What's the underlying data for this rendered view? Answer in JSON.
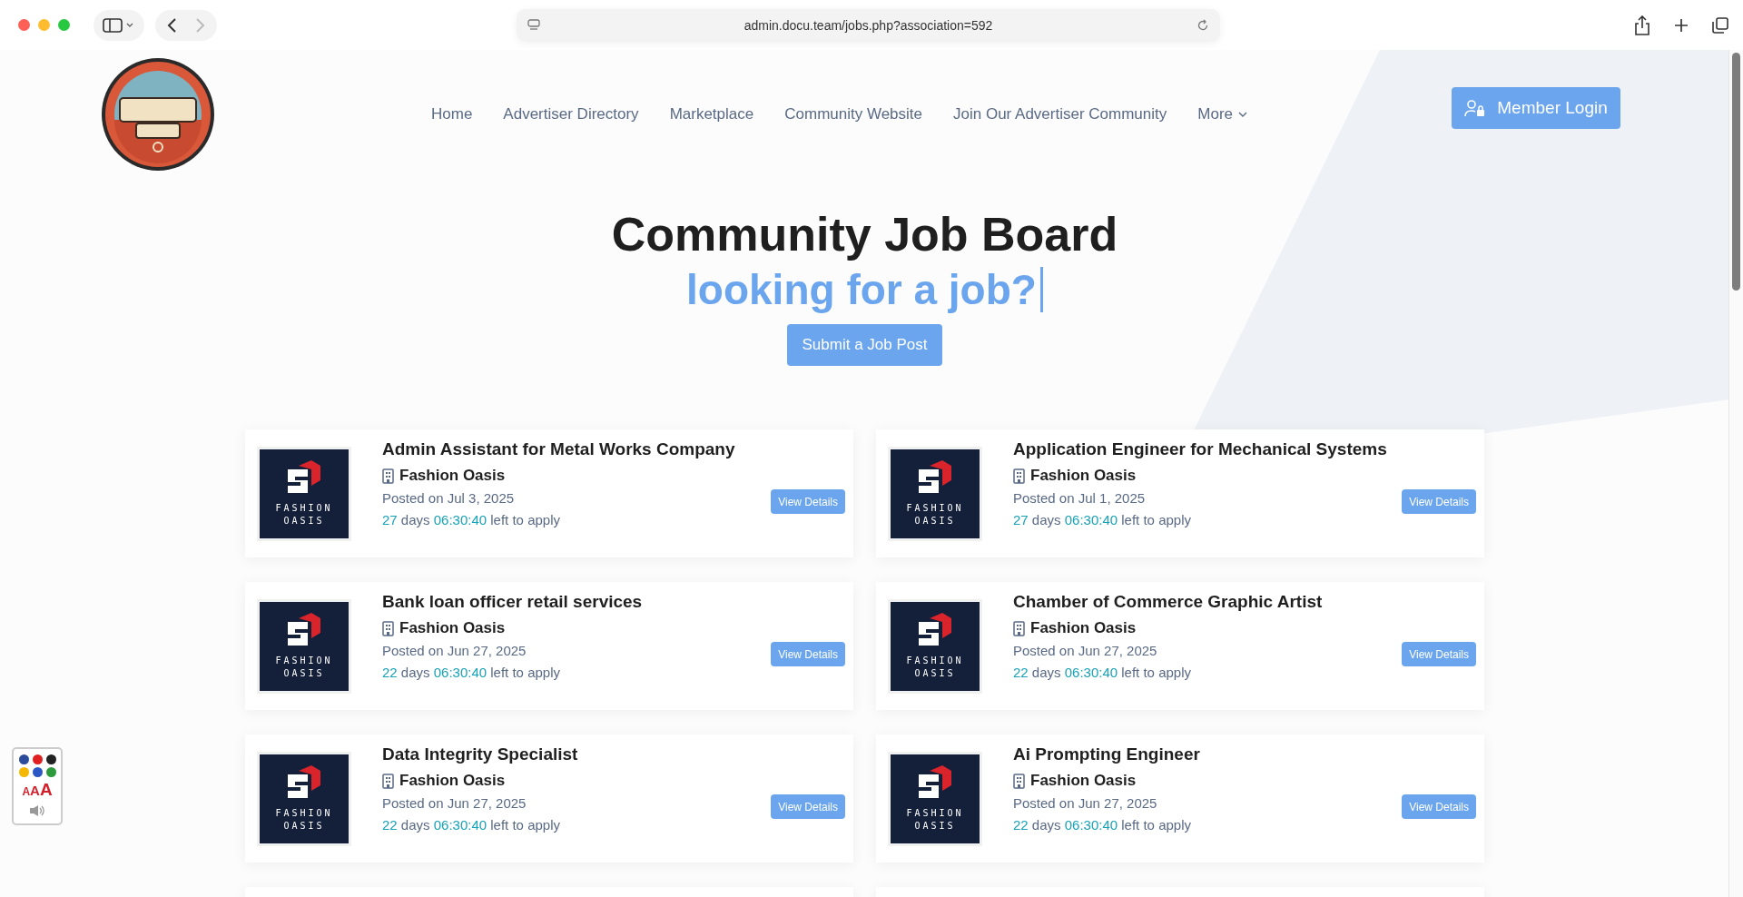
{
  "browser": {
    "url": "admin.docu.team/jobs.php?association=592"
  },
  "nav": {
    "items": [
      {
        "label": "Home",
        "dropdown": false
      },
      {
        "label": "Advertiser Directory",
        "dropdown": false
      },
      {
        "label": "Marketplace",
        "dropdown": false
      },
      {
        "label": "Community Website",
        "dropdown": false
      },
      {
        "label": "Join Our Advertiser Community",
        "dropdown": false
      },
      {
        "label": "More",
        "dropdown": true
      }
    ],
    "login": "Member Login"
  },
  "hero": {
    "title": "Community Job Board",
    "subtitle": "looking for a job?",
    "button": "Submit a Job Post"
  },
  "jobs": [
    {
      "title": "Admin Assistant for Metal Works Company",
      "company": "Fashion Oasis",
      "logo_text": [
        "FASHION",
        "OASIS"
      ],
      "posted": "Posted on Jul 3, 2025",
      "days": "27",
      "days_word": "days",
      "time": "06:30:40",
      "suffix": "left to apply",
      "button": "View Details"
    },
    {
      "title": "Application Engineer for Mechanical Systems",
      "company": "Fashion Oasis",
      "logo_text": [
        "FASHION",
        "OASIS"
      ],
      "posted": "Posted on Jul 1, 2025",
      "days": "27",
      "days_word": "days",
      "time": "06:30:40",
      "suffix": "left to apply",
      "button": "View Details"
    },
    {
      "title": "Bank loan officer retail services",
      "company": "Fashion Oasis",
      "logo_text": [
        "FASHION",
        "OASIS"
      ],
      "posted": "Posted on Jun 27, 2025",
      "days": "22",
      "days_word": "days",
      "time": "06:30:40",
      "suffix": "left to apply",
      "button": "View Details"
    },
    {
      "title": "Chamber of Commerce Graphic Artist",
      "company": "Fashion Oasis",
      "logo_text": [
        "FASHION",
        "OASIS"
      ],
      "posted": "Posted on Jun 27, 2025",
      "days": "22",
      "days_word": "days",
      "time": "06:30:40",
      "suffix": "left to apply",
      "button": "View Details"
    },
    {
      "title": "Data Integrity Specialist",
      "company": "Fashion Oasis",
      "logo_text": [
        "FASHION",
        "OASIS"
      ],
      "posted": "Posted on Jun 27, 2025",
      "days": "22",
      "days_word": "days",
      "time": "06:30:40",
      "suffix": "left to apply",
      "button": "View Details"
    },
    {
      "title": "Ai Prompting Engineer",
      "company": "Fashion Oasis",
      "logo_text": [
        "FASHION",
        "OASIS"
      ],
      "posted": "Posted on Jun 27, 2025",
      "days": "22",
      "days_word": "days",
      "time": "06:30:40",
      "suffix": "left to apply",
      "button": "View Details"
    }
  ],
  "accessibility": {
    "flags": [
      {
        "color": "#2b4c9a"
      },
      {
        "color": "#e02020"
      },
      {
        "color": "#222222"
      },
      {
        "color": "#f5b800"
      },
      {
        "color": "#2a56c6"
      },
      {
        "color": "#2e9a3e"
      }
    ],
    "font_sizes": [
      "A",
      "A",
      "A"
    ]
  }
}
